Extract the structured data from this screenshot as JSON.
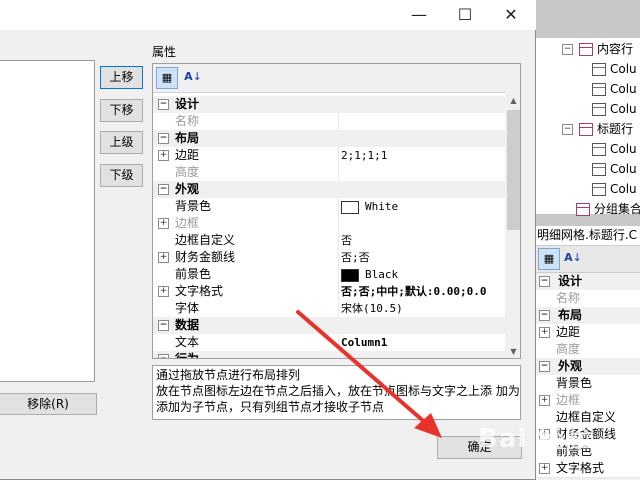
{
  "background_app": {
    "tree": [
      {
        "label": "内容行",
        "level": 1,
        "expander": "−"
      },
      {
        "label": "Colu",
        "level": 2
      },
      {
        "label": "Colu",
        "level": 2
      },
      {
        "label": "Colu",
        "level": 2
      },
      {
        "label": "标题行",
        "level": 1,
        "expander": "−"
      },
      {
        "label": "Colu",
        "level": 2
      },
      {
        "label": "Colu",
        "level": 2
      },
      {
        "label": "Colu",
        "level": 2
      },
      {
        "label": "分组集合",
        "level": 0
      }
    ],
    "panel_title": "明细网格.标题行.C",
    "grid_rows": [
      {
        "type": "cat",
        "label": "设计",
        "expander": "−"
      },
      {
        "type": "item",
        "label": "名称",
        "gray": true
      },
      {
        "type": "cat",
        "label": "布局",
        "expander": "−"
      },
      {
        "type": "item",
        "label": "边距",
        "expander": "+"
      },
      {
        "type": "item",
        "label": "高度",
        "gray": true
      },
      {
        "type": "cat",
        "label": "外观",
        "expander": "−"
      },
      {
        "type": "item",
        "label": "背景色"
      },
      {
        "type": "item",
        "label": "边框",
        "expander": "+",
        "gray": true
      },
      {
        "type": "item",
        "label": "边框自定义"
      },
      {
        "type": "item",
        "label": "财务金额线",
        "expander": "+"
      },
      {
        "type": "item",
        "label": "前景色"
      },
      {
        "type": "item",
        "label": "文字格式",
        "expander": "+"
      }
    ]
  },
  "dialog": {
    "window_buttons": {
      "minimize": "—",
      "maximize": "☐",
      "close": "✕"
    },
    "side_buttons": [
      "上移",
      "下移",
      "上级",
      "下级"
    ],
    "remove_button": "移除(R)",
    "properties_label": "属性",
    "toolbar": {
      "categorized": "▦",
      "alpha": "A↓Z"
    },
    "property_rows": [
      {
        "type": "cat",
        "name": "设计",
        "expander": "−"
      },
      {
        "type": "item",
        "name": "名称",
        "value": "",
        "gray": true
      },
      {
        "type": "cat",
        "name": "布局",
        "expander": "−"
      },
      {
        "type": "item",
        "name": "边距",
        "value": "2;1;1;1",
        "expander": "+"
      },
      {
        "type": "item",
        "name": "高度",
        "value": "",
        "gray": true
      },
      {
        "type": "cat",
        "name": "外观",
        "expander": "−"
      },
      {
        "type": "item",
        "name": "背景色",
        "value": "White",
        "swatch": "#ffffff"
      },
      {
        "type": "item",
        "name": "边框",
        "value": "",
        "expander": "+",
        "gray": true
      },
      {
        "type": "item",
        "name": "边框自定义",
        "value": "否"
      },
      {
        "type": "item",
        "name": "财务金额线",
        "value": "否;否",
        "expander": "+"
      },
      {
        "type": "item",
        "name": "前景色",
        "value": "Black",
        "swatch": "#000000"
      },
      {
        "type": "item",
        "name": "文字格式",
        "value": "否;否;中中;默认:0.00;0.0",
        "expander": "+",
        "bold": true
      },
      {
        "type": "item",
        "name": "字体",
        "value": "宋体(10.5)"
      },
      {
        "type": "cat",
        "name": "数据",
        "expander": "−"
      },
      {
        "type": "item",
        "name": "文本",
        "value": "Column1",
        "bold": true
      },
      {
        "type": "cat",
        "name": "行为",
        "expander": "−"
      }
    ],
    "description_lines": [
      "通过拖放节点进行布局排列",
      "放在节点图标左边在节点之后插入，放在节点图标与文字之上添 加为 子",
      "添加为子节点，只有列组节点才接收子节点"
    ],
    "ok_button": "确定"
  },
  "overlay": {
    "arrow_color": "#e8322c",
    "watermark": "Bai 经验"
  }
}
